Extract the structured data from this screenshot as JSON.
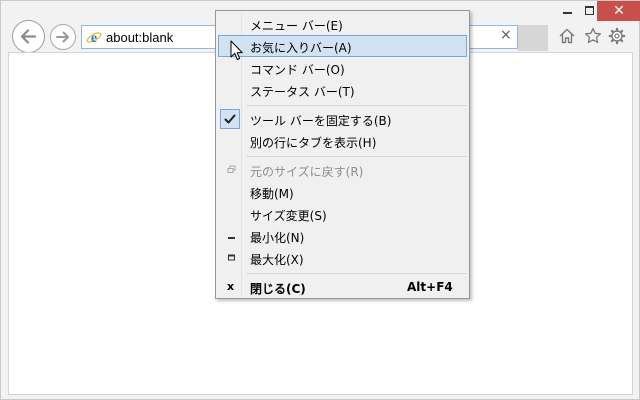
{
  "address_bar": {
    "url": "about:blank",
    "clear_label": "×"
  },
  "caption_buttons": {
    "close_glyph": "✕"
  },
  "icons": {
    "back": "back-arrow-icon",
    "forward": "forward-arrow-icon",
    "ie_logo": "internet-explorer-icon",
    "home": "home-icon",
    "favorites": "star-icon",
    "tools": "gear-icon"
  },
  "colors": {
    "close_button": "#c7504b",
    "menu_hover": "#d1e2f2",
    "menu_hover_border": "#75a7d9",
    "menu_background": "#f0f0f0"
  },
  "context_menu": {
    "items": [
      {
        "label": "メニュー バー(E)"
      },
      {
        "label": "お気に入りバー(A)",
        "state": "hover"
      },
      {
        "label": "コマンド バー(O)"
      },
      {
        "label": "ステータス バー(T)"
      },
      {
        "label": "ツール バーを固定する(B)",
        "checked": true
      },
      {
        "label": "別の行にタブを表示(H)"
      },
      {
        "label": "元のサイズに戻す(R)",
        "disabled": true,
        "icon": "restore-icon"
      },
      {
        "label": "移動(M)"
      },
      {
        "label": "サイズ変更(S)"
      },
      {
        "label": "最小化(N)",
        "icon": "minimize-icon"
      },
      {
        "label": "最大化(X)",
        "icon": "maximize-icon"
      },
      {
        "label": "閉じる(C)",
        "bold": true,
        "accelerator": "Alt+F4",
        "icon": "close-icon",
        "icon_glyph": "x"
      }
    ]
  }
}
